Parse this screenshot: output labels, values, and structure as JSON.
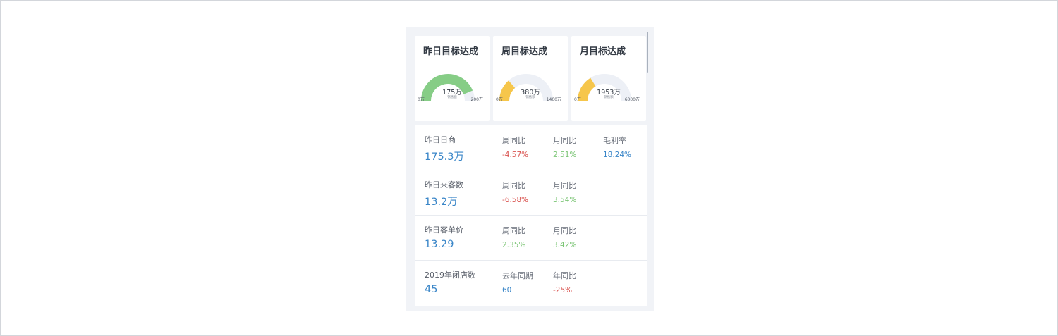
{
  "colors": {
    "accent_blue": "#3a86c8",
    "negative_red": "#d9534f",
    "positive_green": "#7cc576",
    "gauge_green": "#86cd86",
    "gauge_yellow": "#f6c64b",
    "gauge_track": "#edf0f6"
  },
  "goals": [
    {
      "title": "昨日目标达成",
      "value_label": "175万",
      "caption": "销售额",
      "min_label": "0万",
      "max_label": "200万",
      "value": 175,
      "max": 200,
      "color": "#86cd86"
    },
    {
      "title": "周目标达成",
      "value_label": "380万",
      "caption": "销售额",
      "min_label": "0万",
      "max_label": "1400万",
      "value": 380,
      "max": 1400,
      "color": "#f6c64b"
    },
    {
      "title": "月目标达成",
      "value_label": "1953万",
      "caption": "销售额",
      "min_label": "0万",
      "max_label": "6000万",
      "value": 1953,
      "max": 6000,
      "color": "#f6c64b"
    }
  ],
  "metrics": [
    {
      "label": "昨日日商",
      "value": "175.3万",
      "subs": [
        {
          "label": "周同比",
          "value": "-4.57%",
          "color": "#d9534f"
        },
        {
          "label": "月同比",
          "value": "2.51%",
          "color": "#7cc576"
        },
        {
          "label": "毛利率",
          "value": "18.24%",
          "color": "#3a86c8"
        }
      ]
    },
    {
      "label": "昨日来客数",
      "value": "13.2万",
      "subs": [
        {
          "label": "周同比",
          "value": "-6.58%",
          "color": "#d9534f"
        },
        {
          "label": "月同比",
          "value": "3.54%",
          "color": "#7cc576"
        }
      ]
    },
    {
      "label": "昨日客单价",
      "value": "13.29",
      "subs": [
        {
          "label": "周同比",
          "value": "2.35%",
          "color": "#7cc576"
        },
        {
          "label": "月同比",
          "value": "3.42%",
          "color": "#7cc576"
        }
      ]
    },
    {
      "label": "2019年闭店数",
      "value": "45",
      "subs": [
        {
          "label": "去年同期",
          "value": "60",
          "color": "#3a86c8"
        },
        {
          "label": "年同比",
          "value": "-25%",
          "color": "#d9534f"
        }
      ]
    }
  ]
}
